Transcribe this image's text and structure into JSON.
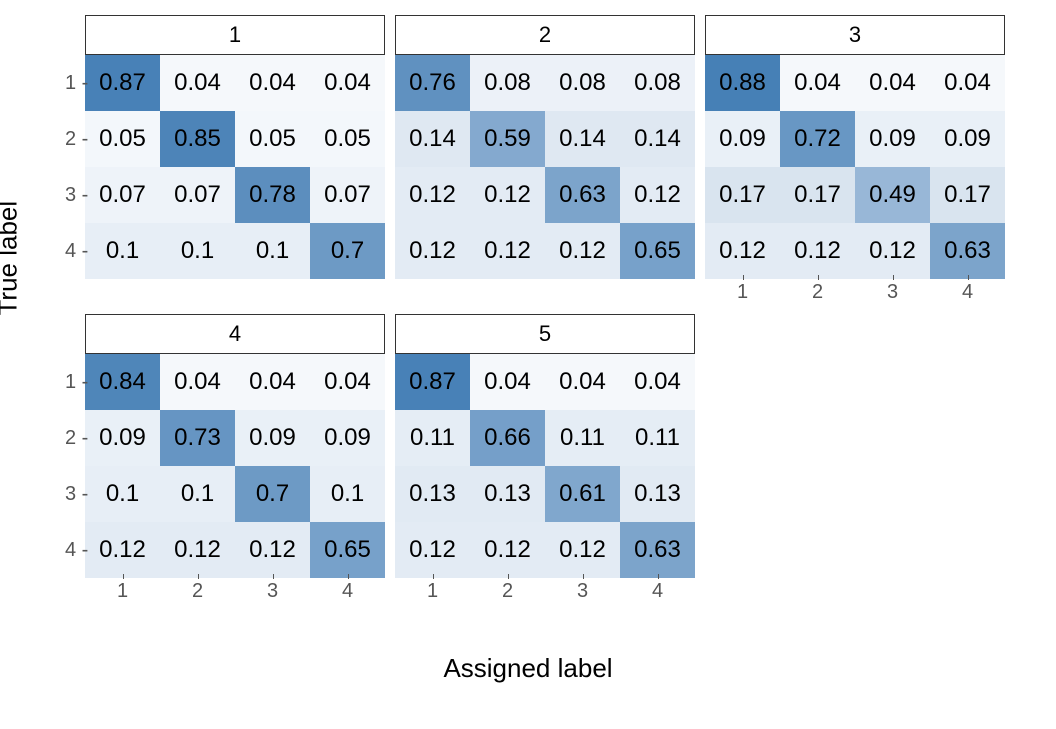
{
  "chart_data": {
    "type": "heatmap",
    "xlabel": "Assigned label",
    "ylabel": "True label",
    "x_categories": [
      "1",
      "2",
      "3",
      "4"
    ],
    "y_categories": [
      "1",
      "2",
      "3",
      "4"
    ],
    "panels": [
      {
        "title": "1",
        "values": [
          [
            0.87,
            0.04,
            0.04,
            0.04
          ],
          [
            0.05,
            0.85,
            0.05,
            0.05
          ],
          [
            0.07,
            0.07,
            0.78,
            0.07
          ],
          [
            0.1,
            0.1,
            0.1,
            0.7
          ]
        ]
      },
      {
        "title": "2",
        "values": [
          [
            0.76,
            0.08,
            0.08,
            0.08
          ],
          [
            0.14,
            0.59,
            0.14,
            0.14
          ],
          [
            0.12,
            0.12,
            0.63,
            0.12
          ],
          [
            0.12,
            0.12,
            0.12,
            0.65
          ]
        ]
      },
      {
        "title": "3",
        "values": [
          [
            0.88,
            0.04,
            0.04,
            0.04
          ],
          [
            0.09,
            0.72,
            0.09,
            0.09
          ],
          [
            0.17,
            0.17,
            0.49,
            0.17
          ],
          [
            0.12,
            0.12,
            0.12,
            0.63
          ]
        ]
      },
      {
        "title": "4",
        "values": [
          [
            0.84,
            0.04,
            0.04,
            0.04
          ],
          [
            0.09,
            0.73,
            0.09,
            0.09
          ],
          [
            0.1,
            0.1,
            0.7,
            0.1
          ],
          [
            0.12,
            0.12,
            0.12,
            0.65
          ]
        ]
      },
      {
        "title": "5",
        "values": [
          [
            0.87,
            0.04,
            0.04,
            0.04
          ],
          [
            0.11,
            0.66,
            0.11,
            0.11
          ],
          [
            0.13,
            0.13,
            0.61,
            0.13
          ],
          [
            0.12,
            0.12,
            0.12,
            0.63
          ]
        ]
      }
    ]
  }
}
